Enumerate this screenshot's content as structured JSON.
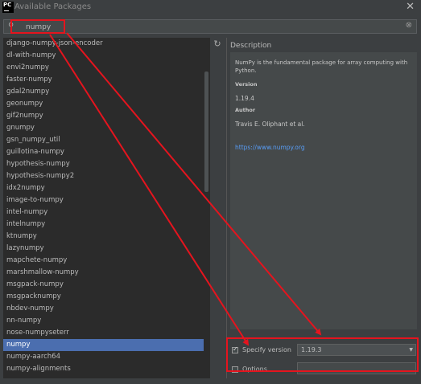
{
  "window": {
    "title": "Available Packages",
    "close_glyph": "✕",
    "app_icon_text": "PC"
  },
  "search": {
    "value": "numpy",
    "icon": "search-icon",
    "clear_glyph": "⊗"
  },
  "packages": [
    "django-numpy-json-encoder",
    "dl-with-numpy",
    "envi2numpy",
    "faster-numpy",
    "gdal2numpy",
    "geonumpy",
    "gif2numpy",
    "gnumpy",
    "gsn_numpy_util",
    "guillotina-numpy",
    "hypothesis-numpy",
    "hypothesis-numpy2",
    "idx2numpy",
    "image-to-numpy",
    "intel-numpy",
    "intelnumpy",
    "ktnumpy",
    "lazynumpy",
    "mapchete-numpy",
    "marshmallow-numpy",
    "msgpack-numpy",
    "msgpacknumpy",
    "nbdev-numpy",
    "nn-numpy",
    "nose-numpyseterr",
    "numpy",
    "numpy-aarch64",
    "numpy-alignments"
  ],
  "selected_package": "numpy",
  "description": {
    "heading": "Description",
    "summary": "NumPy is the fundamental package for array computing with Python.",
    "version_label": "Version",
    "version_value": "1.19.4",
    "author_label": "Author",
    "author_value": "Travis E. Oliphant et al.",
    "link": "https://www.numpy.org"
  },
  "options": {
    "specify_version_label": "Specify version",
    "specify_version_checked": true,
    "version_selected": "1.19.3",
    "options_label": "Options",
    "options_checked": false,
    "options_value": ""
  },
  "colors": {
    "background": "#3c3f41",
    "list_background": "#2b2b2b",
    "selection": "#4b6eaf",
    "link": "#589df6",
    "annotation": "#e5141e"
  }
}
